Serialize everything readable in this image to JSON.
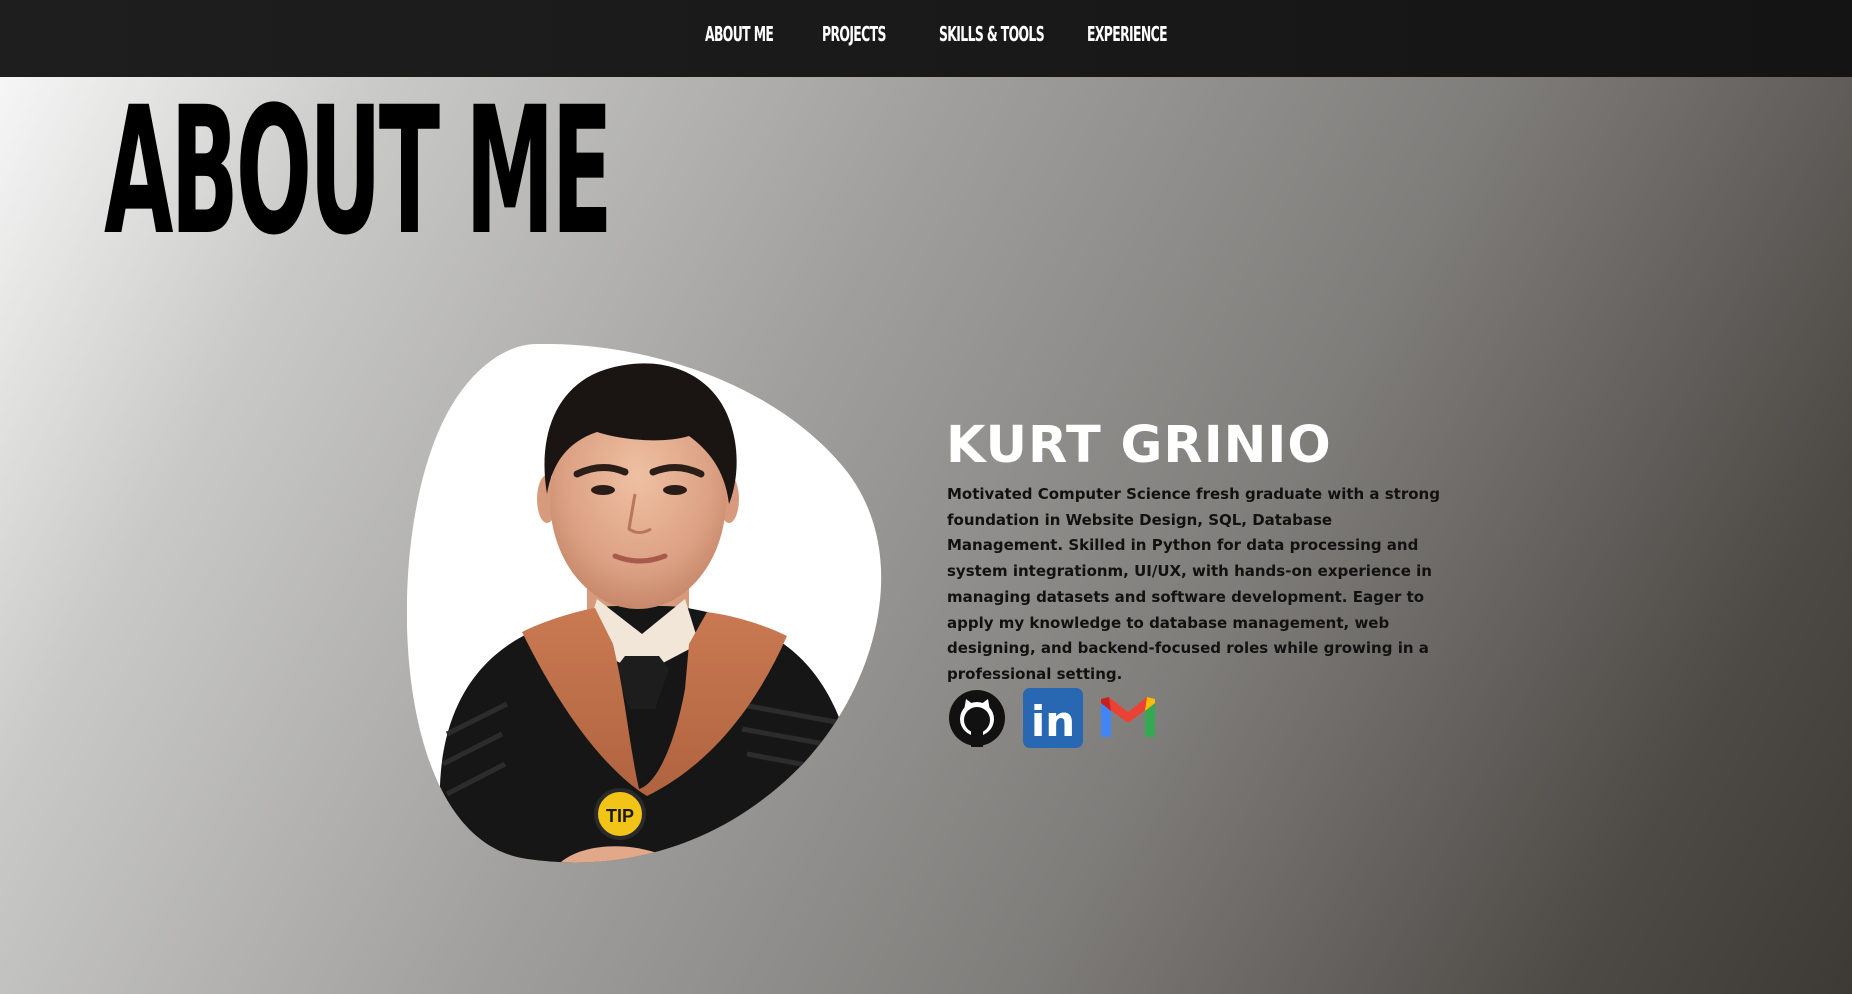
{
  "nav": {
    "items": [
      {
        "label": "ABOUT ME"
      },
      {
        "label": "PROJECTS"
      },
      {
        "label": "SKILLS & TOOLS"
      },
      {
        "label": "EXPERIENCE"
      }
    ]
  },
  "hero": {
    "title": "ABOUT ME"
  },
  "profile": {
    "photo_alt": "Graduation portrait of Kurt Grinio",
    "medal_text": "TIP",
    "name": "KURT GRINIO",
    "bio": "Motivated Computer Science fresh graduate with a strong foundation in Website Design, SQL, Database Management. Skilled in Python for data processing and system integrationm, UI/UX, with hands-on experience in managing datasets and software development. Eager to apply my knowledge to database management, web designing, and backend-focused roles while growing in a professional setting."
  },
  "social": {
    "links": [
      {
        "icon": "github-icon"
      },
      {
        "icon": "linkedin-icon",
        "text": "in"
      },
      {
        "icon": "gmail-icon"
      }
    ]
  },
  "colors": {
    "nav_background": "#1a1a1a",
    "title": "#000000",
    "name": "#ffffff",
    "bio": "#111111",
    "linkedin": "#2867b2",
    "gown": "#111111",
    "hood": "#c0714a",
    "medal": "#f2c418"
  }
}
